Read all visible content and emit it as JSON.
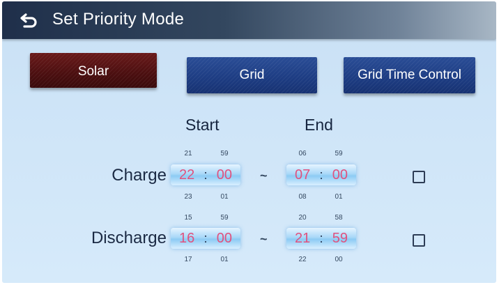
{
  "header": {
    "title": "Set Priority Mode",
    "back_icon": "back-arrow-icon"
  },
  "modes": {
    "solar": "Solar",
    "grid": "Grid",
    "grid_time_control": "Grid Time Control",
    "selected": "Solar"
  },
  "columns": {
    "start": "Start",
    "end": "End"
  },
  "rows": {
    "charge": {
      "label": "Charge",
      "start": {
        "hour": "22",
        "minute": "00",
        "hour_prev": "21",
        "hour_next": "23",
        "minute_prev": "59",
        "minute_next": "01"
      },
      "end": {
        "hour": "07",
        "minute": "00",
        "hour_prev": "06",
        "hour_next": "08",
        "minute_prev": "59",
        "minute_next": "01"
      },
      "enabled": false
    },
    "discharge": {
      "label": "Discharge",
      "start": {
        "hour": "16",
        "minute": "00",
        "hour_prev": "15",
        "hour_next": "17",
        "minute_prev": "59",
        "minute_next": "01"
      },
      "end": {
        "hour": "21",
        "minute": "59",
        "hour_prev": "20",
        "hour_next": "22",
        "minute_prev": "58",
        "minute_next": "00"
      },
      "enabled": false
    }
  },
  "separators": {
    "colon": ":",
    "tilde": "~"
  },
  "colors": {
    "solar_selected": "#4b0f10",
    "mode_button": "#1d3c82",
    "time_digits": "#e0527e"
  }
}
